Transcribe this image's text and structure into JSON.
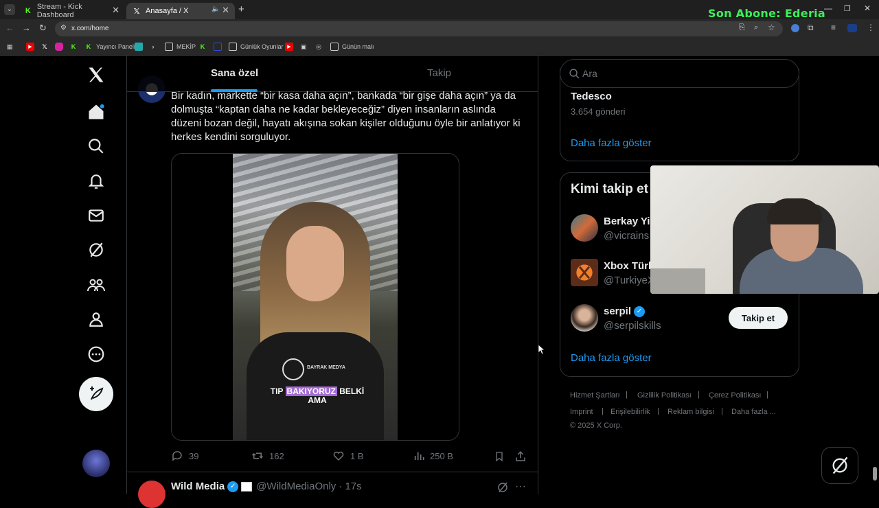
{
  "browser": {
    "tabs": [
      {
        "title": "Stream - Kick Dashboard",
        "favicon": "K"
      },
      {
        "title": "Anasayfa / X",
        "favicon": "X"
      }
    ],
    "url": "x.com/home",
    "bookmarks": [
      {
        "label": "Yayıncı Paneli"
      },
      {
        "label": "MEKİP"
      },
      {
        "label": "Günlük Oyunlar"
      },
      {
        "label": "Günün malı"
      }
    ]
  },
  "stream_overlay": {
    "text": "Son Abone: Ederia"
  },
  "feed": {
    "tabs": [
      {
        "label": "Sana özel"
      },
      {
        "label": "Takip"
      }
    ],
    "tweet": {
      "text": "Bir kadın, markette “bir kasa daha açın”, bankada “bir gişe daha açın” ya da dolmuşta “kaptan daha ne kadar bekleyeceğiz” diyen insanların aslında düzeni bozan değil, hayatı akışına sokan kişiler olduğunu öyle bir anlatıyor ki herkes kendini sorguluyor.",
      "video_caption_1": "TIP",
      "video_caption_highlight": "BAKIYORUZ",
      "video_caption_2": "BELKİ",
      "video_caption_3": "AMA",
      "video_brand": "BAYRAK MEDYA",
      "replies": "39",
      "reposts": "162",
      "likes": "1 B",
      "views": "250 B"
    },
    "next_tweet": {
      "author": "Wild Media",
      "handle": "@WildMediaOnly",
      "time": "· 17s"
    }
  },
  "sidebar": {
    "search_placeholder": "Ara",
    "trend_card": {
      "name": "Tedesco",
      "count": "3.654 gönderi",
      "show_more": "Daha fazla göster"
    },
    "who_to_follow": {
      "title": "Kimi takip et",
      "users": [
        {
          "name": "Berkay Yi",
          "handle": "@vicrains"
        },
        {
          "name": "Xbox Türk",
          "handle": "@TurkiyeX"
        },
        {
          "name": "serpil",
          "handle": "@serpilskills"
        }
      ],
      "follow_label": "Takip et",
      "show_more": "Daha fazla göster"
    },
    "footer": {
      "links": [
        "Hizmet Şartları",
        "Gizlilik Politikası",
        "Çerez Politikası",
        "Imprint",
        "Erişilebilirlik",
        "Reklam bilgisi",
        "Daha fazla ..."
      ],
      "copyright": "© 2025 X Corp."
    }
  },
  "colors": {
    "accent": "#1d9bf0",
    "overlay_green": "#3cf05a"
  }
}
